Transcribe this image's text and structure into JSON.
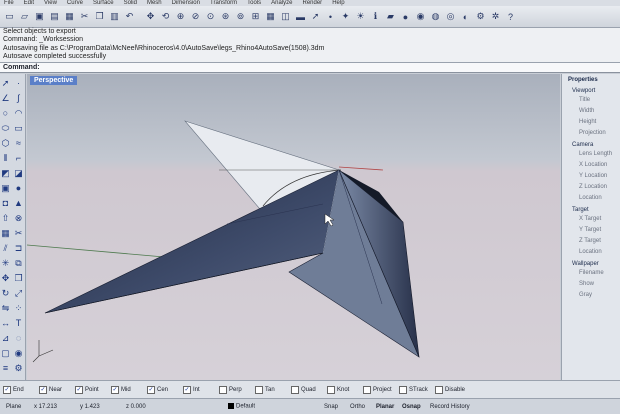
{
  "menu": [
    "File",
    "Edit",
    "View",
    "Curve",
    "Surface",
    "Solid",
    "Mesh",
    "Dimension",
    "Transform",
    "Tools",
    "Analyze",
    "Render",
    "Help"
  ],
  "command_history": [
    "Select objects to export",
    "Command: _Worksession",
    "Autosaving file as C:\\ProgramData\\McNeel\\Rhinoceros\\4.0\\AutoSave\\legs_Rhino4AutoSave(1508).3dm",
    "Autosave completed successfully"
  ],
  "command_prompt": "Command:",
  "viewport": {
    "title": "Perspective"
  },
  "properties": {
    "title": "Properties",
    "viewport_header": "Viewport",
    "viewport_rows": [
      "Title",
      "Width",
      "Height",
      "Projection"
    ],
    "camera_header": "Camera",
    "camera_rows": [
      "Lens Length",
      "X Location",
      "Y Location",
      "Z Location",
      "Location"
    ],
    "target_header": "Target",
    "target_rows": [
      "X Target",
      "Y Target",
      "Z Target",
      "Location"
    ],
    "wallpaper_header": "Wallpaper",
    "wallpaper_rows": [
      "Filename",
      "Show",
      "Gray"
    ]
  },
  "osnaps": [
    {
      "label": "End",
      "checked": true
    },
    {
      "label": "Near",
      "checked": true
    },
    {
      "label": "Point",
      "checked": true
    },
    {
      "label": "Mid",
      "checked": true
    },
    {
      "label": "Cen",
      "checked": true
    },
    {
      "label": "Int",
      "checked": true
    },
    {
      "label": "Perp",
      "checked": false
    },
    {
      "label": "Tan",
      "checked": false
    },
    {
      "label": "Quad",
      "checked": false
    },
    {
      "label": "Knot",
      "checked": false
    },
    {
      "label": "Project",
      "checked": false
    },
    {
      "label": "STrack",
      "checked": false
    },
    {
      "label": "Disable",
      "checked": false
    }
  ],
  "status": {
    "plane": "Plane",
    "x": "x 17.213",
    "y": "y 1.423",
    "z": "z 0.000",
    "layer": "Default",
    "toggles": [
      "Snap",
      "Ortho",
      "Planar",
      "Osnap",
      "Record History"
    ]
  },
  "colors": {
    "viewport_title_bg": "#5b7fc8",
    "shape_dark": "#2f3a55",
    "shape_light": "#e4e8ee"
  }
}
